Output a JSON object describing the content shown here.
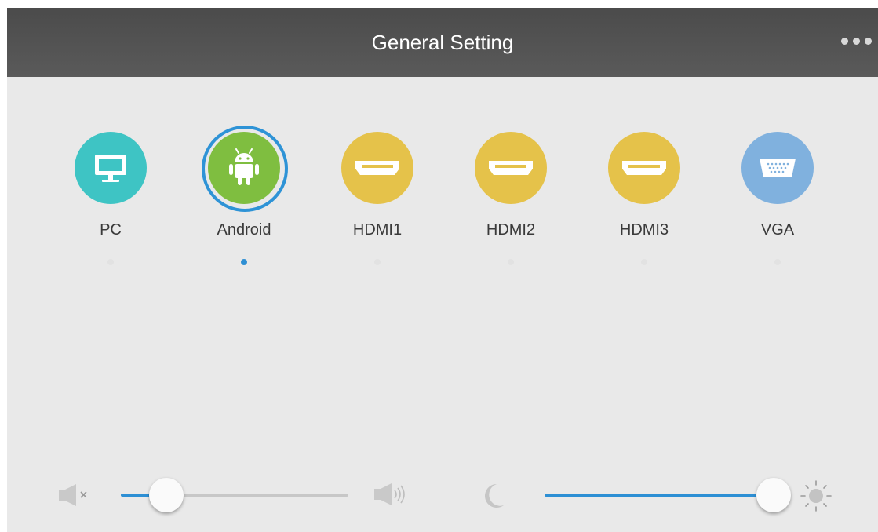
{
  "header": {
    "title": "General Setting",
    "more_icon": "more-dots-icon"
  },
  "sources": [
    {
      "label": "PC",
      "icon": "monitor-icon",
      "color": "#3dc3c6",
      "selected": false
    },
    {
      "label": "Android",
      "icon": "android-icon",
      "color": "#7fbf3d",
      "selected": true
    },
    {
      "label": "HDMI1",
      "icon": "hdmi-port-icon",
      "color": "#e3c04a",
      "selected": false
    },
    {
      "label": "HDMI2",
      "icon": "hdmi-port-icon",
      "color": "#e3c04a",
      "selected": false
    },
    {
      "label": "HDMI3",
      "icon": "hdmi-port-icon",
      "color": "#e3c04a",
      "selected": false
    },
    {
      "label": "VGA",
      "icon": "vga-port-icon",
      "color": "#7fb0dd",
      "selected": false
    }
  ],
  "controls": {
    "volume": {
      "value_fraction": 0.2,
      "min_icon": "volume-mute-icon",
      "max_icon": "volume-up-icon"
    },
    "brightness": {
      "value_fraction": 1.0,
      "min_icon": "moon-icon",
      "max_icon": "sun-icon"
    }
  },
  "colors": {
    "accent": "#2e8fd3",
    "header": "#505050",
    "background": "#e9e9e9"
  }
}
